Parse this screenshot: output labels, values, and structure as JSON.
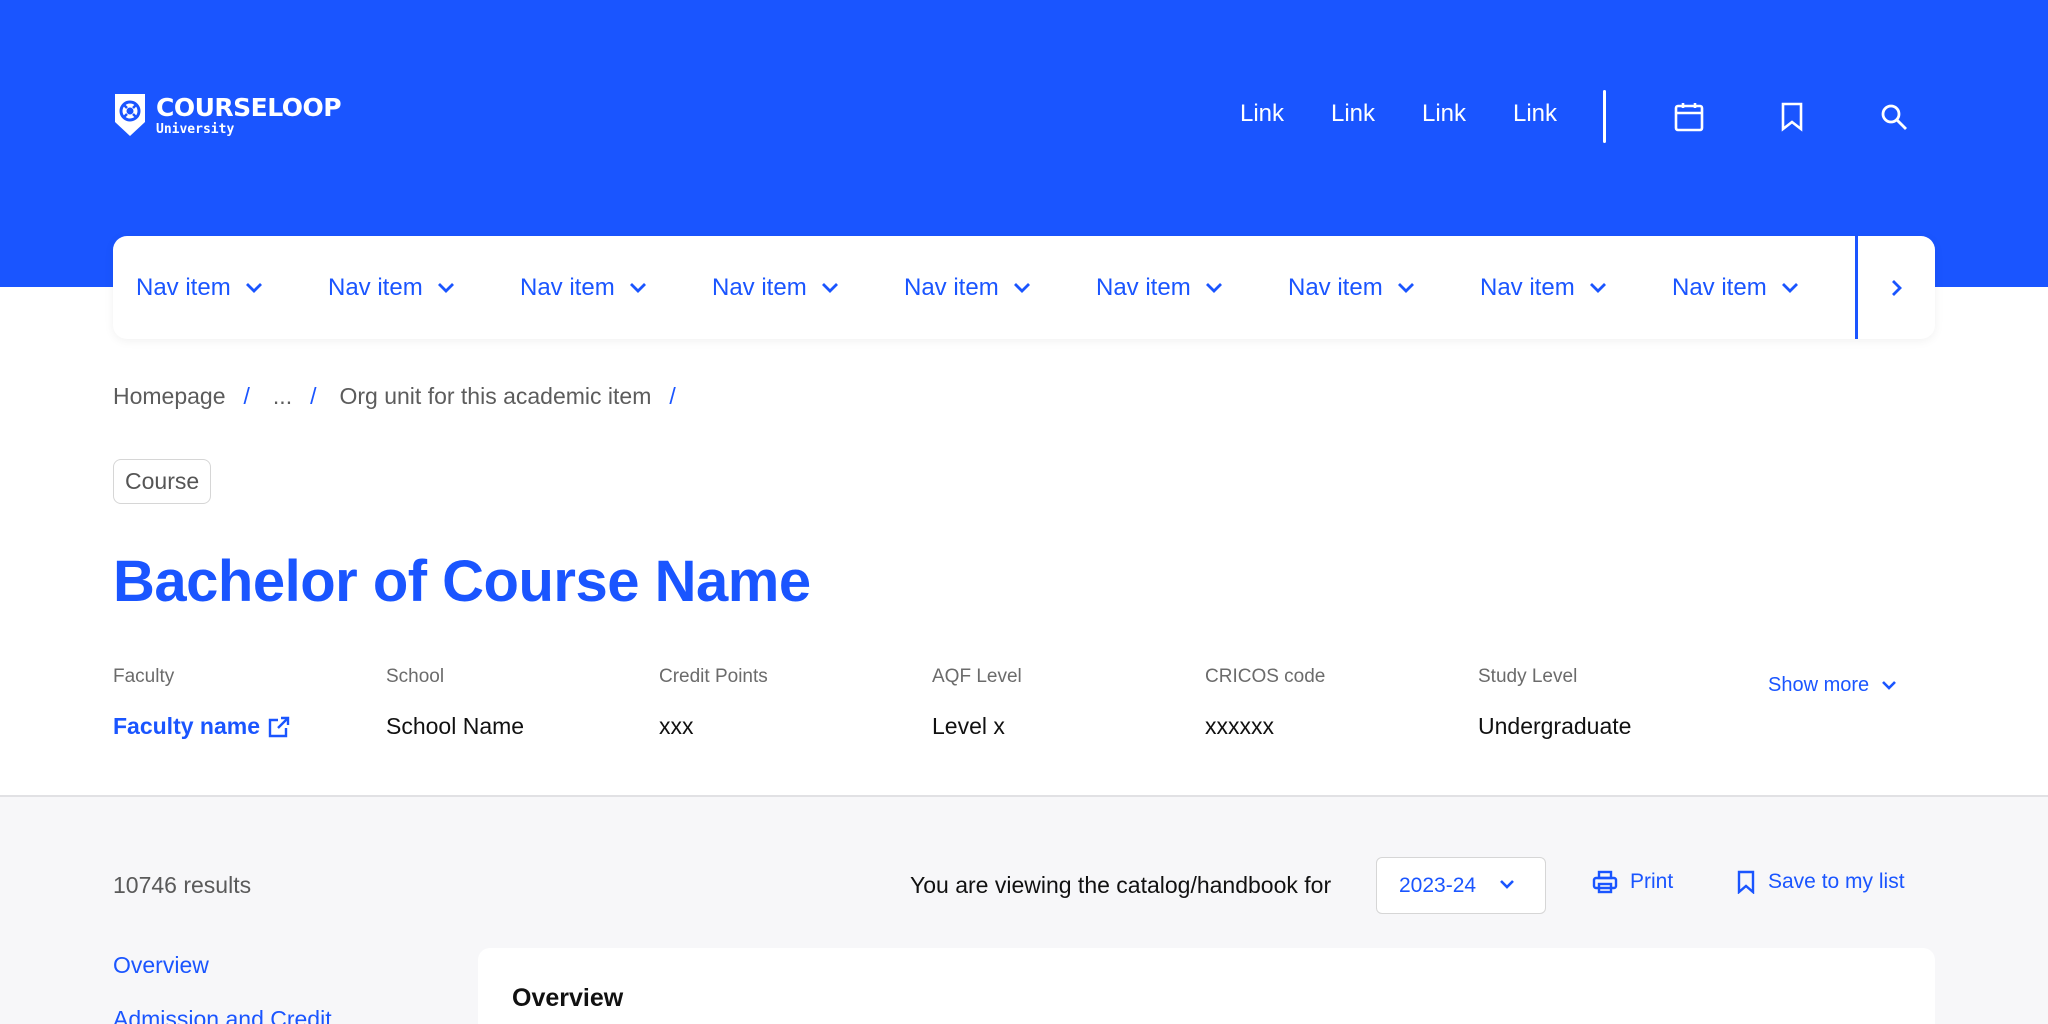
{
  "colors": {
    "brand": "#1a55ff",
    "background": "#ffffff",
    "lower_background": "#f7f7f9"
  },
  "logo": {
    "brand": "COURSELOOP",
    "subtitle": "University"
  },
  "top_links": [
    "Link",
    "Link",
    "Link",
    "Link"
  ],
  "top_icons": [
    "calendar-icon",
    "bookmark-icon",
    "search-icon"
  ],
  "nav": {
    "items": [
      "Nav item",
      "Nav item",
      "Nav item",
      "Nav item",
      "Nav item",
      "Nav item",
      "Nav item",
      "Nav item",
      "Nav item"
    ]
  },
  "breadcrumb": {
    "items": [
      "Homepage",
      "...",
      "Org unit for this academic item"
    ],
    "separator": "/"
  },
  "chip": "Course",
  "title": "Bachelor of Course Name",
  "meta": [
    {
      "label": "Faculty",
      "value": "Faculty name"
    },
    {
      "label": "School",
      "value": "School Name"
    },
    {
      "label": "Credit Points",
      "value": "xxx"
    },
    {
      "label": "AQF Level",
      "value": "Level x"
    },
    {
      "label": "CRICOS code",
      "value": "xxxxxx"
    },
    {
      "label": "Study Level",
      "value": "Undergraduate"
    }
  ],
  "show_more": "Show more",
  "toolbar": {
    "results": "10746 results",
    "viewing_label": "You are viewing the catalog/handbook for",
    "year": "2023-24",
    "print": "Print",
    "save": "Save to my list"
  },
  "sidebar": {
    "items": [
      "Overview",
      "Admission and Credit"
    ]
  },
  "content": {
    "heading": "Overview"
  }
}
